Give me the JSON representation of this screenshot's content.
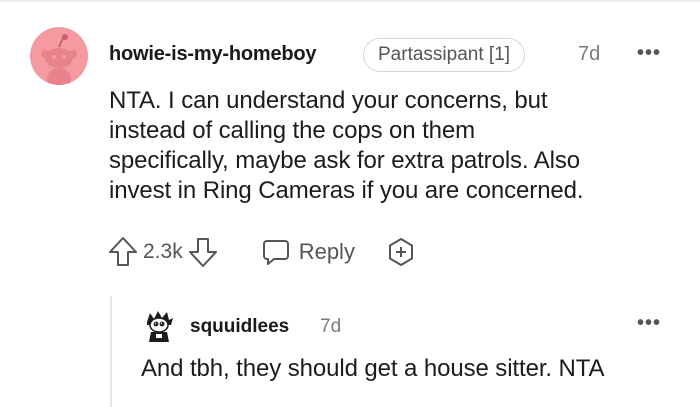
{
  "comment": {
    "author": "howie-is-my-homeboy",
    "flair": "Partassipant [1]",
    "time": "7d",
    "more_label": "•••",
    "body_lines": [
      "NTA. I can understand your concerns, but",
      "instead of calling the cops on them",
      "specifically, maybe ask for extra patrols. Also",
      "invest in Ring Cameras if you are concerned."
    ],
    "score": "2.3k",
    "reply_label": "Reply",
    "avatar_color": "#f59aa0"
  },
  "reply": {
    "author": "squuidlees",
    "time": "7d",
    "more_label": "•••",
    "text": "And tbh, they should get a house sitter. NTA"
  }
}
